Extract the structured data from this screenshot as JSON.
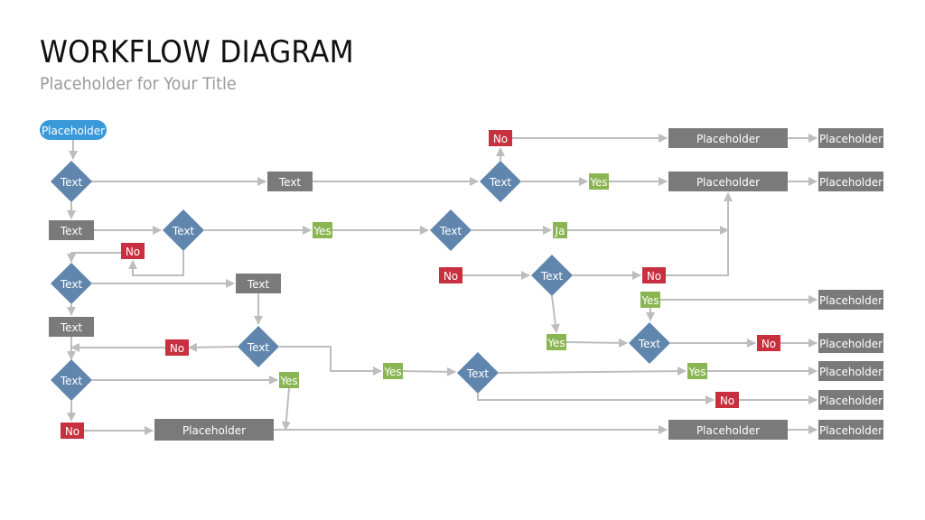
{
  "header": {
    "title": "WORKFLOW DIAGRAM",
    "subtitle": "Placeholder for Your Title"
  },
  "colors": {
    "start": "#3a9ad9",
    "decision": "#6186ad",
    "process": "#7a7a7a",
    "yes": "#8bb553",
    "no": "#c8303f",
    "connector": "#bdbdbd"
  },
  "nodes": [
    {
      "id": "start",
      "type": "start",
      "label": "Placeholder"
    },
    {
      "id": "d1",
      "type": "decision",
      "label": "Text"
    },
    {
      "id": "p1",
      "type": "process",
      "label": "Text"
    },
    {
      "id": "d2",
      "type": "decision",
      "label": "Text"
    },
    {
      "id": "no_top",
      "type": "no",
      "label": "No"
    },
    {
      "id": "pA",
      "type": "process",
      "label": "Placeholder"
    },
    {
      "id": "pA2",
      "type": "process",
      "label": "Placeholder"
    },
    {
      "id": "yes_top",
      "type": "yes",
      "label": "Yes"
    },
    {
      "id": "pB",
      "type": "process",
      "label": "Placeholder"
    },
    {
      "id": "pB2",
      "type": "process",
      "label": "Placeholder"
    },
    {
      "id": "p2",
      "type": "process",
      "label": "Text"
    },
    {
      "id": "d3",
      "type": "decision",
      "label": "Text"
    },
    {
      "id": "yes1",
      "type": "yes",
      "label": "Yes"
    },
    {
      "id": "d4",
      "type": "decision",
      "label": "Text"
    },
    {
      "id": "ja",
      "type": "yes",
      "label": "Ja"
    },
    {
      "id": "no1",
      "type": "no",
      "label": "No"
    },
    {
      "id": "d5",
      "type": "decision",
      "label": "Text"
    },
    {
      "id": "no_mid",
      "type": "no",
      "label": "No"
    },
    {
      "id": "no_r",
      "type": "no",
      "label": "No"
    },
    {
      "id": "p3",
      "type": "process",
      "label": "Text"
    },
    {
      "id": "yes_r1",
      "type": "yes",
      "label": "Yes"
    },
    {
      "id": "pC",
      "type": "process",
      "label": "Placeholder"
    },
    {
      "id": "yes_r2",
      "type": "yes",
      "label": "Yes"
    },
    {
      "id": "d6",
      "type": "decision",
      "label": "Text"
    },
    {
      "id": "no_r2",
      "type": "no",
      "label": "No"
    },
    {
      "id": "pD",
      "type": "process",
      "label": "Placeholder"
    },
    {
      "id": "p4",
      "type": "process",
      "label": "Text"
    },
    {
      "id": "d7",
      "type": "decision",
      "label": "Text"
    },
    {
      "id": "no2",
      "type": "no",
      "label": "No"
    },
    {
      "id": "d8",
      "type": "decision",
      "label": "Text"
    },
    {
      "id": "yes_mid",
      "type": "yes",
      "label": "Yes"
    },
    {
      "id": "d9",
      "type": "decision",
      "label": "Text"
    },
    {
      "id": "yes_r3",
      "type": "yes",
      "label": "Yes"
    },
    {
      "id": "pE",
      "type": "process",
      "label": "Placeholder"
    },
    {
      "id": "no_r3",
      "type": "no",
      "label": "No"
    },
    {
      "id": "pF",
      "type": "process",
      "label": "Placeholder"
    },
    {
      "id": "yes2",
      "type": "yes",
      "label": "Yes"
    },
    {
      "id": "no3",
      "type": "no",
      "label": "No"
    },
    {
      "id": "p5",
      "type": "process",
      "label": "Placeholder"
    },
    {
      "id": "pG",
      "type": "process",
      "label": "Placeholder"
    },
    {
      "id": "pG2",
      "type": "process",
      "label": "Placeholder"
    }
  ]
}
